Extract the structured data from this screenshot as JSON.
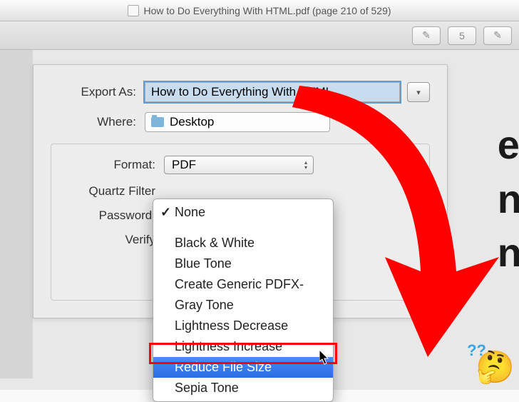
{
  "titlebar": {
    "text": "How to Do Everything With HTML.pdf (page 210 of 529)"
  },
  "toolbar": {
    "btn1": "✎",
    "btn2": "5",
    "btn3": "✎"
  },
  "export": {
    "label": "Export As:",
    "value": "How to Do Everything With HTML"
  },
  "where": {
    "label": "Where:",
    "value": "Desktop"
  },
  "format": {
    "label": "Format:",
    "value": "PDF"
  },
  "quartz": {
    "label": "Quartz Filter"
  },
  "password": {
    "label": "Password:"
  },
  "verify": {
    "label": "Verify"
  },
  "menu": {
    "none": "None",
    "bw": "Black & White",
    "blue": "Blue Tone",
    "pdfx": "Create Generic PDFX-",
    "gray": "Gray Tone",
    "ldec": "Lightness Decrease",
    "linc": "Lightness Increase",
    "reduce": "Reduce File Size",
    "sepia": "Sepia Tone"
  },
  "bg": {
    "line1": "es",
    "line2": "nt",
    "line3": "n"
  },
  "emoji": {
    "face": "🤔",
    "q": "??"
  }
}
